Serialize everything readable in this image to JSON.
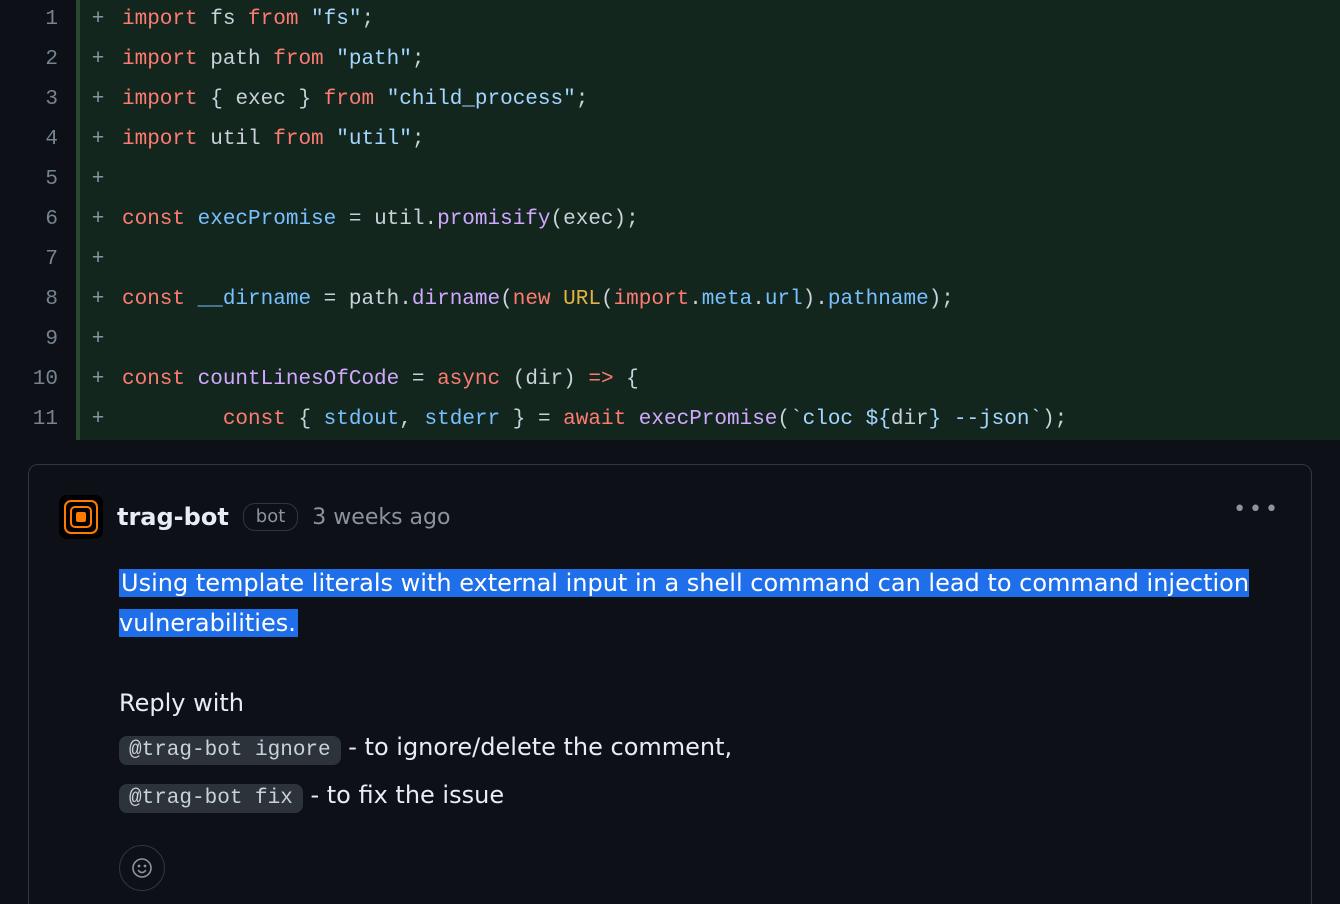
{
  "code": {
    "lines": [
      {
        "num": "1",
        "marker": "+",
        "tokens": [
          [
            "keyword",
            "import "
          ],
          [
            "ident",
            "fs "
          ],
          [
            "keyword",
            "from "
          ],
          [
            "string",
            "\"fs\""
          ],
          [
            "punc",
            ";"
          ]
        ]
      },
      {
        "num": "2",
        "marker": "+",
        "tokens": [
          [
            "keyword",
            "import "
          ],
          [
            "ident",
            "path "
          ],
          [
            "keyword",
            "from "
          ],
          [
            "string",
            "\"path\""
          ],
          [
            "punc",
            ";"
          ]
        ]
      },
      {
        "num": "3",
        "marker": "+",
        "tokens": [
          [
            "keyword",
            "import "
          ],
          [
            "punc",
            "{ "
          ],
          [
            "ident",
            "exec"
          ],
          [
            "punc",
            " } "
          ],
          [
            "keyword",
            "from "
          ],
          [
            "string",
            "\"child_process\""
          ],
          [
            "punc",
            ";"
          ]
        ]
      },
      {
        "num": "4",
        "marker": "+",
        "tokens": [
          [
            "keyword",
            "import "
          ],
          [
            "ident",
            "util "
          ],
          [
            "keyword",
            "from "
          ],
          [
            "string",
            "\"util\""
          ],
          [
            "punc",
            ";"
          ]
        ]
      },
      {
        "num": "5",
        "marker": "+",
        "tokens": []
      },
      {
        "num": "6",
        "marker": "+",
        "tokens": [
          [
            "keyword",
            "const "
          ],
          [
            "const",
            "execPromise"
          ],
          [
            "punc",
            " = "
          ],
          [
            "ident",
            "util"
          ],
          [
            "punc",
            "."
          ],
          [
            "func",
            "promisify"
          ],
          [
            "punc",
            "("
          ],
          [
            "ident",
            "exec"
          ],
          [
            "punc",
            ");"
          ]
        ]
      },
      {
        "num": "7",
        "marker": "+",
        "tokens": []
      },
      {
        "num": "8",
        "marker": "+",
        "tokens": [
          [
            "keyword",
            "const "
          ],
          [
            "const",
            "__dirname"
          ],
          [
            "punc",
            " = "
          ],
          [
            "ident",
            "path"
          ],
          [
            "punc",
            "."
          ],
          [
            "func",
            "dirname"
          ],
          [
            "punc",
            "("
          ],
          [
            "keyword",
            "new "
          ],
          [
            "class",
            "URL"
          ],
          [
            "punc",
            "("
          ],
          [
            "keyword",
            "import"
          ],
          [
            "punc",
            "."
          ],
          [
            "prop",
            "meta"
          ],
          [
            "punc",
            "."
          ],
          [
            "prop",
            "url"
          ],
          [
            "punc",
            ")."
          ],
          [
            "prop",
            "pathname"
          ],
          [
            "punc",
            ");"
          ]
        ]
      },
      {
        "num": "9",
        "marker": "+",
        "tokens": []
      },
      {
        "num": "10",
        "marker": "+",
        "tokens": [
          [
            "keyword",
            "const "
          ],
          [
            "func",
            "countLinesOfCode"
          ],
          [
            "punc",
            " = "
          ],
          [
            "keyword",
            "async "
          ],
          [
            "punc",
            "("
          ],
          [
            "ident",
            "dir"
          ],
          [
            "punc",
            ") "
          ],
          [
            "keyword",
            "=>"
          ],
          [
            "punc",
            " {"
          ]
        ]
      },
      {
        "num": "11",
        "marker": "+",
        "tokens": [
          [
            "ident",
            "        "
          ],
          [
            "keyword",
            "const "
          ],
          [
            "punc",
            "{ "
          ],
          [
            "const",
            "stdout"
          ],
          [
            "punc",
            ", "
          ],
          [
            "const",
            "stderr"
          ],
          [
            "punc",
            " } = "
          ],
          [
            "keyword",
            "await "
          ],
          [
            "func",
            "execPromise"
          ],
          [
            "punc",
            "("
          ],
          [
            "string",
            "`cloc ${"
          ],
          [
            "ident",
            "dir"
          ],
          [
            "string",
            "} --json`"
          ],
          [
            "punc",
            ");"
          ]
        ]
      }
    ]
  },
  "comment": {
    "author": "trag-bot",
    "badge": "bot",
    "timestamp": "3 weeks ago",
    "highlighted_text": "Using template literals with external input in a shell command can lead to command injection vulnerabilities.",
    "reply_with_label": "Reply with",
    "actions": [
      {
        "code": "@trag-bot ignore",
        "desc": " - to ignore/delete the comment,"
      },
      {
        "code": "@trag-bot fix",
        "desc": " - to fix the issue"
      }
    ],
    "kebab": "•••"
  }
}
